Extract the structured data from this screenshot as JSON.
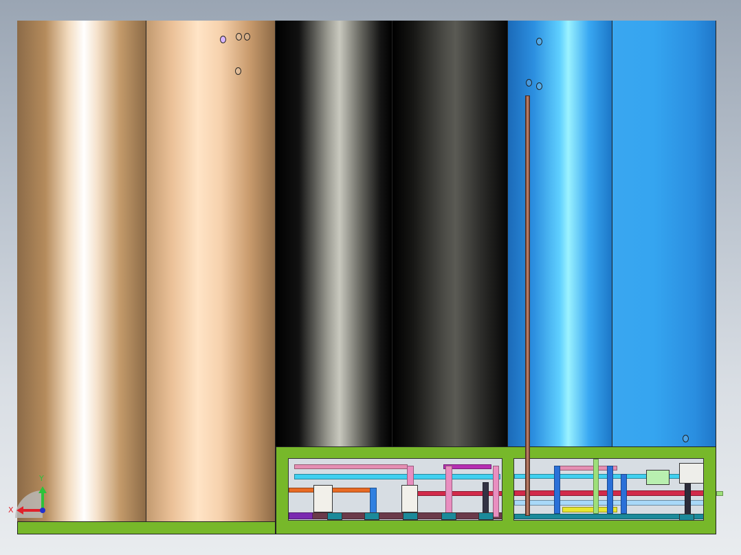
{
  "viewport": {
    "background": "gradient-gray",
    "scene": "tank-and-piping-assembly"
  },
  "tanks": [
    {
      "name": "copper-tank-left",
      "color": "#d9a878"
    },
    {
      "name": "copper-tank-right",
      "color": "#f2c79c"
    },
    {
      "name": "black-tank-left",
      "color": "#000000"
    },
    {
      "name": "black-tank-right",
      "color": "#3c3c38"
    },
    {
      "name": "blue-tank-left",
      "color": "#35a9f0"
    },
    {
      "name": "blue-tank-right",
      "color": "#2f9be8"
    }
  ],
  "base_color": "#77b82a",
  "axis_triad": {
    "x_label": "X",
    "y_label": "Y",
    "x_color": "#e0202a",
    "y_color": "#2cc23a",
    "z_color": "#2030d0"
  }
}
